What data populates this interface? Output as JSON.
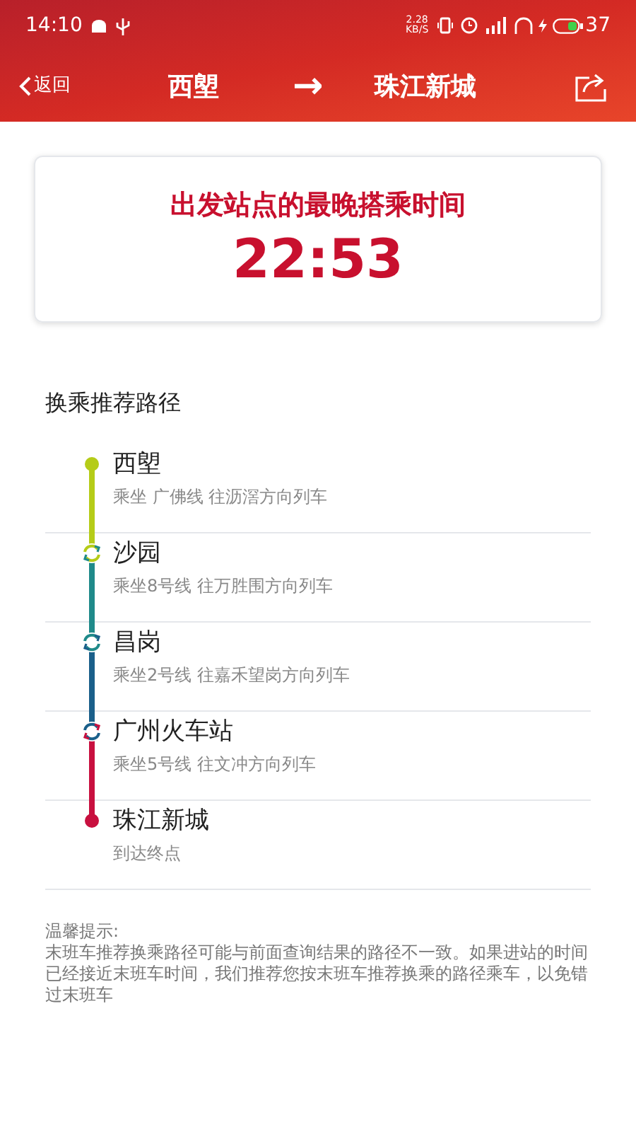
{
  "status_bar": {
    "time": "14:10",
    "net_speed": "2.28",
    "net_unit": "KB/S",
    "battery": "37"
  },
  "header": {
    "back": "返回",
    "from": "西塱",
    "arrow": "→",
    "to": "珠江新城"
  },
  "last_train": {
    "title": "出发站点的最晚搭乘时间",
    "time": "22:53"
  },
  "route": {
    "title": "换乘推荐路径",
    "stops": [
      {
        "kind": "start",
        "name": "西塱",
        "detail": "乘坐 广佛线 往沥滘方向列车",
        "color": "#b5cc18"
      },
      {
        "kind": "transfer",
        "name": "沙园",
        "detail": "乘坐8号线 往万胜围方向列车",
        "color": "#1f8a8a"
      },
      {
        "kind": "transfer",
        "name": "昌岗",
        "detail": "乘坐2号线 往嘉禾望岗方向列车",
        "color": "#1a5f8a"
      },
      {
        "kind": "transfer",
        "name": "广州火车站",
        "detail": "乘坐5号线 往文冲方向列车",
        "color": "#c8103f"
      },
      {
        "kind": "end",
        "name": "珠江新城",
        "detail": "到达终点",
        "color": "#c8103f"
      }
    ]
  },
  "notice": {
    "title": "温馨提示:",
    "body": "末班车推荐换乘路径可能与前面查询结果的路径不一致。如果进站的时间已经接近末班车时间，我们推荐您按末班车推荐换乘的路径乘车，以免错过末班车"
  }
}
